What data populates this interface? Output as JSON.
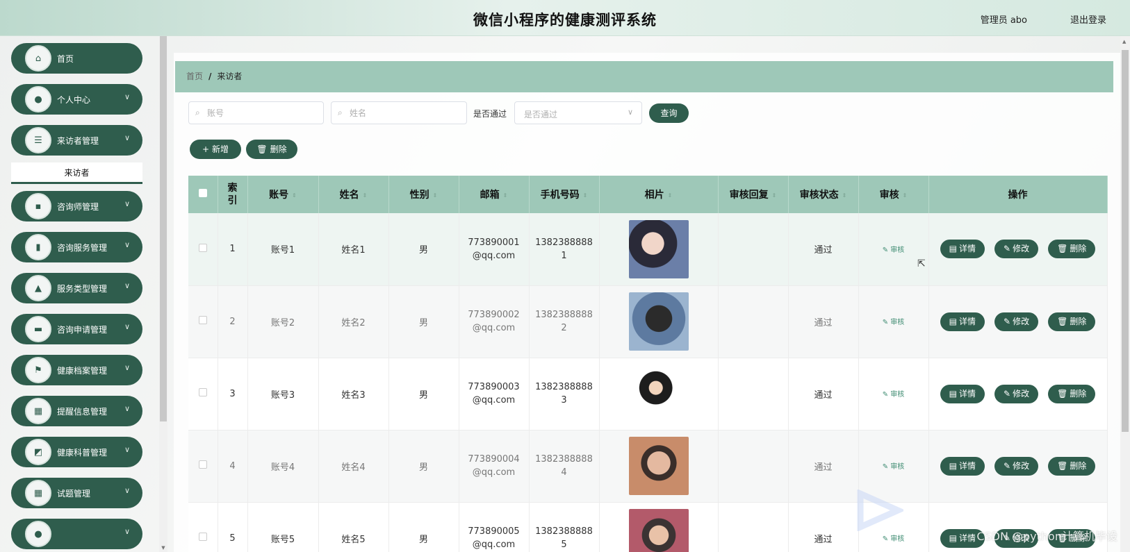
{
  "header": {
    "title": "微信小程序的健康测评系统",
    "user": "管理员 abo",
    "logout": "退出登录"
  },
  "sidebar": {
    "items": [
      {
        "label": "首页",
        "icon": "home-icon",
        "glyph": "⌂",
        "has_children": false
      },
      {
        "label": "个人中心",
        "icon": "person-icon",
        "glyph": "●",
        "has_children": true
      },
      {
        "label": "来访者管理",
        "icon": "list-icon",
        "glyph": "☰",
        "has_children": true
      },
      {
        "label": "咨询师管理",
        "icon": "chat-icon",
        "glyph": "▪",
        "has_children": true
      },
      {
        "label": "咨询服务管理",
        "icon": "stamp-icon",
        "glyph": "▮",
        "has_children": true
      },
      {
        "label": "服务类型管理",
        "icon": "user-card-icon",
        "glyph": "▲",
        "has_children": true
      },
      {
        "label": "咨询申请管理",
        "icon": "briefcase-icon",
        "glyph": "▬",
        "has_children": true
      },
      {
        "label": "健康档案管理",
        "icon": "flag-icon",
        "glyph": "⚑",
        "has_children": true
      },
      {
        "label": "提醒信息管理",
        "icon": "grid-icon",
        "glyph": "▦",
        "has_children": true
      },
      {
        "label": "健康科普管理",
        "icon": "chart-icon",
        "glyph": "◩",
        "has_children": true
      },
      {
        "label": "试题管理",
        "icon": "grid-icon",
        "glyph": "▦",
        "has_children": true
      },
      {
        "label": "",
        "icon": "menu-icon",
        "glyph": "●",
        "has_children": true
      }
    ],
    "active_sub": "来访者"
  },
  "breadcrumb": {
    "home": "首页",
    "current": "来访者"
  },
  "filters": {
    "account_placeholder": "账号",
    "name_placeholder": "姓名",
    "pass_label": "是否通过",
    "pass_placeholder": "是否通过",
    "query": "查询"
  },
  "actions": {
    "add": "新增",
    "delete": "删除"
  },
  "table": {
    "headers": {
      "index": "索引",
      "account": "账号",
      "name": "姓名",
      "gender": "性别",
      "email": "邮箱",
      "phone": "手机号码",
      "photo": "相片",
      "reply": "审核回复",
      "status": "审核状态",
      "audit": "审核",
      "ops": "操作"
    },
    "audit_label": "审核",
    "op_detail": "详情",
    "op_edit": "修改",
    "op_delete": "删除",
    "rows": [
      {
        "index": "1",
        "account": "账号1",
        "name": "姓名1",
        "gender": "男",
        "email": "773890001@qq.com",
        "phone": "13823888881",
        "reply": "",
        "status": "通过"
      },
      {
        "index": "2",
        "account": "账号2",
        "name": "姓名2",
        "gender": "男",
        "email": "773890002@qq.com",
        "phone": "13823888882",
        "reply": "",
        "status": "通过"
      },
      {
        "index": "3",
        "account": "账号3",
        "name": "姓名3",
        "gender": "男",
        "email": "773890003@qq.com",
        "phone": "13823888883",
        "reply": "",
        "status": "通过"
      },
      {
        "index": "4",
        "account": "账号4",
        "name": "姓名4",
        "gender": "男",
        "email": "773890004@qq.com",
        "phone": "13823888884",
        "reply": "",
        "status": "通过"
      },
      {
        "index": "5",
        "account": "账号5",
        "name": "姓名5",
        "gender": "男",
        "email": "773890005@qq.com",
        "phone": "13823888885",
        "reply": "",
        "status": "通过"
      }
    ]
  },
  "colors": {
    "primary": "#2f5d4d",
    "header_row": "#9ec8b8",
    "link": "#3f8c72"
  },
  "watermark": "CSDN @python计算机毕设"
}
